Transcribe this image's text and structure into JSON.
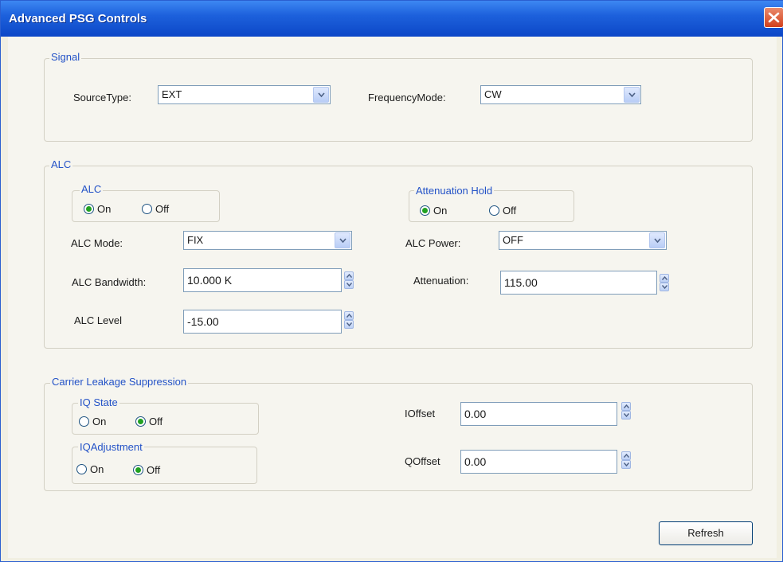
{
  "window": {
    "title": "Advanced PSG Controls"
  },
  "signal": {
    "title": "Signal",
    "source_type_label": "SourceType:",
    "source_type_value": "EXT",
    "frequency_mode_label": "FrequencyMode:",
    "frequency_mode_value": "CW"
  },
  "alc": {
    "title": "ALC",
    "alc_group": {
      "title": "ALC",
      "on_label": "On",
      "off_label": "Off",
      "selected": "On"
    },
    "attenuation_hold": {
      "title": "Attenuation Hold",
      "on_label": "On",
      "off_label": "Off",
      "selected": "On"
    },
    "mode_label": "ALC Mode:",
    "mode_value": "FIX",
    "power_label": "ALC Power:",
    "power_value": "OFF",
    "bandwidth_label": "ALC Bandwidth:",
    "bandwidth_value": "10.000 K",
    "attenuation_label": "Attenuation:",
    "attenuation_value": "115.00",
    "level_label": "ALC Level",
    "level_value": "-15.00"
  },
  "carrier": {
    "title": "Carrier Leakage Suppression",
    "iq_state": {
      "title": "IQ State",
      "on_label": "On",
      "off_label": "Off",
      "selected": "Off"
    },
    "iq_adjustment": {
      "title": "IQAdjustment",
      "on_label": "On",
      "off_label": "Off",
      "selected": "Off"
    },
    "ioffset_label": "IOffset",
    "ioffset_value": "0.00",
    "qoffset_label": "QOffset",
    "qoffset_value": "0.00"
  },
  "refresh_label": "Refresh",
  "colors": {
    "title_bar": "#0c47c7",
    "group_title": "#2352c7",
    "radio_checked": "#21a121",
    "close_button": "#d3401c"
  }
}
